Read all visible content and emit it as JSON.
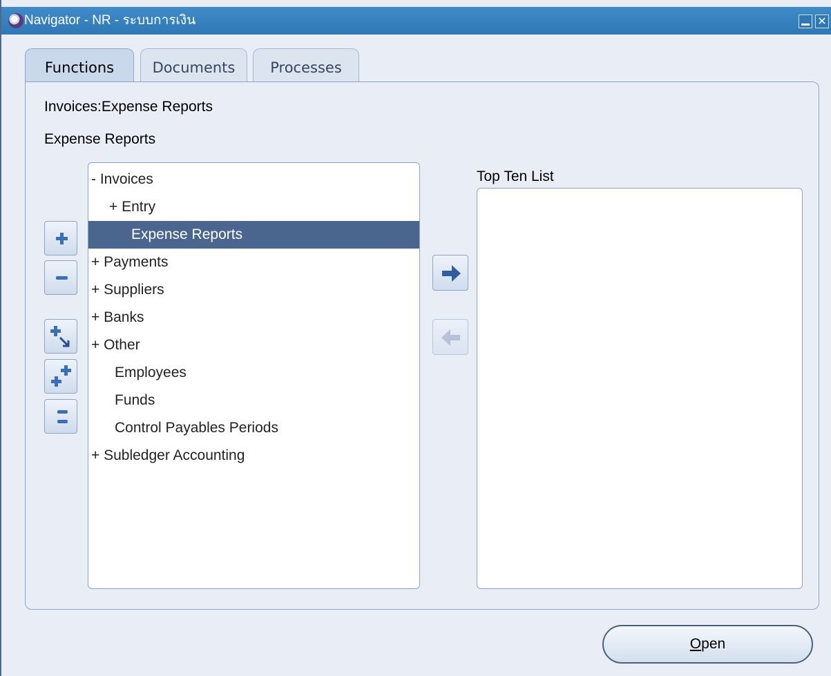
{
  "window": {
    "title": "Navigator - NR - ระบบการเงิน",
    "minimize_label": "",
    "close_label": "✕"
  },
  "tabs": [
    {
      "label": "Functions",
      "active": true
    },
    {
      "label": "Documents",
      "active": false
    },
    {
      "label": "Processes",
      "active": false
    }
  ],
  "path_label": "Invoices:Expense Reports",
  "current_label": "Expense Reports",
  "top_ten_label": "Top Ten List",
  "tree": [
    {
      "text": "- Invoices",
      "indent": 0
    },
    {
      "text": "+ Entry",
      "indent": 1
    },
    {
      "text": "Expense Reports",
      "indent": 2,
      "selected": true
    },
    {
      "text": "+ Payments",
      "indent": 0
    },
    {
      "text": "+ Suppliers",
      "indent": 0
    },
    {
      "text": "+ Banks",
      "indent": 0
    },
    {
      "text": "+ Other",
      "indent": 0
    },
    {
      "text": "Employees",
      "indent": 0
    },
    {
      "text": "Funds",
      "indent": 0
    },
    {
      "text": "Control Payables Periods",
      "indent": 0
    },
    {
      "text": "+ Subledger Accounting",
      "indent": 0
    }
  ],
  "buttons": {
    "open_label_mnemonic": "O",
    "open_label_rest": "pen"
  },
  "icons": {
    "expand": "plus-icon",
    "collapse": "minus-icon",
    "expand_branch": "plus-arrow-icon",
    "expand_all": "double-plus-icon",
    "collapse_all": "double-minus-icon",
    "add_to_list": "right-arrow-icon",
    "remove_from_list": "left-arrow-icon"
  },
  "colors": {
    "titlebar": "#2f78b6",
    "selection": "#4a658e",
    "panel": "#e9eef6"
  }
}
